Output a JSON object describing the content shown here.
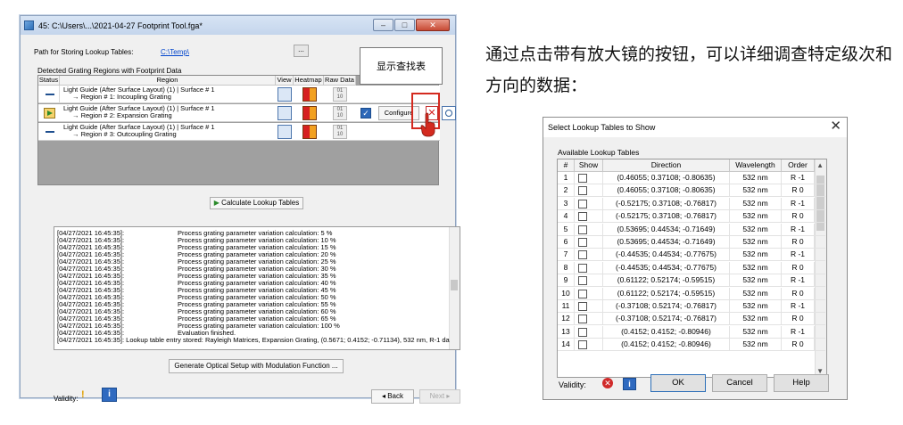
{
  "window": {
    "title": "45: C:\\Users\\...\\2021-04-27 Footprint Tool.fga*",
    "path_label": "Path for Storing Lookup Tables:",
    "path_value": "C:\\Temp\\",
    "browse_label": "...",
    "group_label": "Detected Grating Regions with Footprint Data",
    "columns": [
      "Status",
      "Region",
      "View",
      "Heatmap",
      "Raw Data"
    ],
    "rows": [
      {
        "line1": "Light Guide (After Surface Layout) (1) | Surface # 1",
        "line2": "→ Region # 1: Incoupling Grating",
        "status": "dash"
      },
      {
        "line1": "Light Guide (After Surface Layout) (1) | Surface # 1",
        "line2": "→ Region # 2: Expansion Grating",
        "status": "arrow"
      },
      {
        "line1": "Light Guide (After Surface Layout) (1) | Surface # 1",
        "line2": "→ Region # 3: Outcoupling Grating",
        "status": "dash"
      }
    ],
    "configure_label": "Configure",
    "raw_icon_text": "01\n10",
    "tooltip": "显示查找表",
    "calc_button": "Calculate Lookup Tables",
    "log": [
      {
        "t": "[04/27/2021 16:45:35]:",
        "m": "Process grating parameter variation calculation: 5 %"
      },
      {
        "t": "[04/27/2021 16:45:35]:",
        "m": "Process grating parameter variation calculation: 10 %"
      },
      {
        "t": "[04/27/2021 16:45:35]:",
        "m": "Process grating parameter variation calculation: 15 %"
      },
      {
        "t": "[04/27/2021 16:45:35]:",
        "m": "Process grating parameter variation calculation: 20 %"
      },
      {
        "t": "[04/27/2021 16:45:35]:",
        "m": "Process grating parameter variation calculation: 25 %"
      },
      {
        "t": "[04/27/2021 16:45:35]:",
        "m": "Process grating parameter variation calculation: 30 %"
      },
      {
        "t": "[04/27/2021 16:45:35]:",
        "m": "Process grating parameter variation calculation: 35 %"
      },
      {
        "t": "[04/27/2021 16:45:35]:",
        "m": "Process grating parameter variation calculation: 40 %"
      },
      {
        "t": "[04/27/2021 16:45:35]:",
        "m": "Process grating parameter variation calculation: 45 %"
      },
      {
        "t": "[04/27/2021 16:45:35]:",
        "m": "Process grating parameter variation calculation: 50 %"
      },
      {
        "t": "[04/27/2021 16:45:35]:",
        "m": "Process grating parameter variation calculation: 55 %"
      },
      {
        "t": "[04/27/2021 16:45:35]:",
        "m": "Process grating parameter variation calculation: 60 %"
      },
      {
        "t": "[04/27/2021 16:45:35]:",
        "m": "Process grating parameter variation calculation: 65 %"
      },
      {
        "t": "[04/27/2021 16:45:35]:",
        "m": "Process grating parameter variation calculation: 100 %"
      },
      {
        "t": "[04/27/2021 16:45:35]:",
        "m": "Evaluation finished."
      },
      {
        "t": "[04/27/2021 16:45:35]: Lookup table entry stored: Rayleigh Matrices, Expansion Grating, (0.5671; 0.4152; -0.71134), 532 nm, R-1 da",
        "m": ""
      }
    ],
    "generate_button": "Generate Optical Setup with Modulation Function ...",
    "validity_label": "Validity:",
    "back_button": "◂ Back",
    "next_button": "Next ▸"
  },
  "caption": "通过点击带有放大镜的按钮，可以详细调查特定级次和方向的数据：",
  "dialog": {
    "title": "Select Lookup Tables to Show",
    "section_label": "Available Lookup Tables",
    "columns": [
      "#",
      "Show",
      "Direction",
      "Wavelength",
      "Order"
    ],
    "rows": [
      {
        "n": "1",
        "dir": "(0.46055; 0.37108; -0.80635)",
        "wl": "532 nm",
        "ord": "R -1"
      },
      {
        "n": "2",
        "dir": "(0.46055; 0.37108; -0.80635)",
        "wl": "532 nm",
        "ord": "R 0"
      },
      {
        "n": "3",
        "dir": "(-0.52175; 0.37108; -0.76817)",
        "wl": "532 nm",
        "ord": "R -1"
      },
      {
        "n": "4",
        "dir": "(-0.52175; 0.37108; -0.76817)",
        "wl": "532 nm",
        "ord": "R 0"
      },
      {
        "n": "5",
        "dir": "(0.53695; 0.44534; -0.71649)",
        "wl": "532 nm",
        "ord": "R -1"
      },
      {
        "n": "6",
        "dir": "(0.53695; 0.44534; -0.71649)",
        "wl": "532 nm",
        "ord": "R 0"
      },
      {
        "n": "7",
        "dir": "(-0.44535; 0.44534; -0.77675)",
        "wl": "532 nm",
        "ord": "R -1"
      },
      {
        "n": "8",
        "dir": "(-0.44535; 0.44534; -0.77675)",
        "wl": "532 nm",
        "ord": "R 0"
      },
      {
        "n": "9",
        "dir": "(0.61122; 0.52174; -0.59515)",
        "wl": "532 nm",
        "ord": "R -1"
      },
      {
        "n": "10",
        "dir": "(0.61122; 0.52174; -0.59515)",
        "wl": "532 nm",
        "ord": "R 0"
      },
      {
        "n": "11",
        "dir": "(-0.37108; 0.52174; -0.76817)",
        "wl": "532 nm",
        "ord": "R -1"
      },
      {
        "n": "12",
        "dir": "(-0.37108; 0.52174; -0.76817)",
        "wl": "532 nm",
        "ord": "R 0"
      },
      {
        "n": "13",
        "dir": "(0.4152; 0.4152; -0.80946)",
        "wl": "532 nm",
        "ord": "R -1"
      },
      {
        "n": "14",
        "dir": "(0.4152; 0.4152; -0.80946)",
        "wl": "532 nm",
        "ord": "R 0"
      }
    ],
    "validity_label": "Validity:",
    "ok": "OK",
    "cancel": "Cancel",
    "help": "Help"
  }
}
